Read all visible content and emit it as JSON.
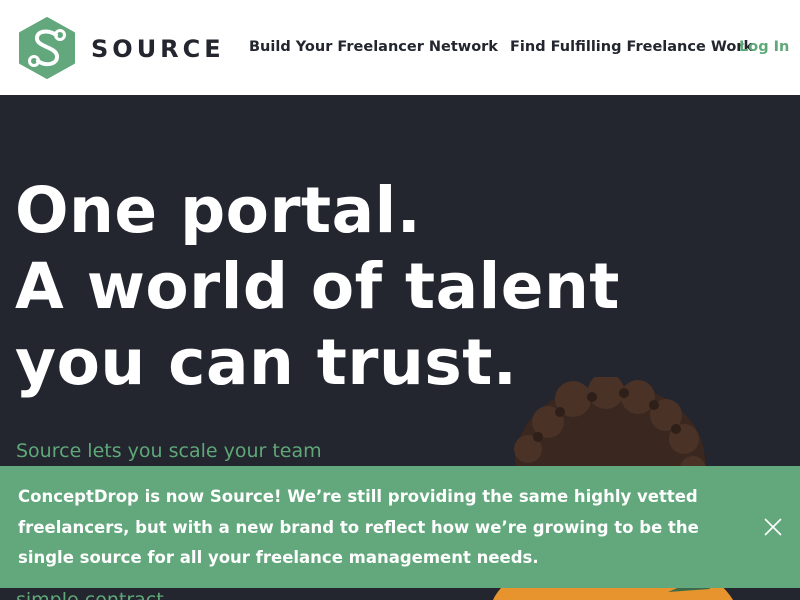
{
  "brand": {
    "name": "SOURCE",
    "accent": "#5fa878",
    "dark": "#23252f"
  },
  "nav": {
    "build_label": "Build Your Freelancer Network",
    "find_label": "Find Fulfilling Freelance Work",
    "login_label": "Log In"
  },
  "hero": {
    "headline": [
      "One portal.",
      "A world of talent",
      "you can trust."
    ],
    "subtext": "Source lets you scale your team",
    "subtext_partial": "simple contract"
  },
  "banner": {
    "message": "ConceptDrop is now Source! We’re still providing the same highly vetted freelancers, but with a new brand to reflect how we’re growing to be the single source for all your freelance management needs.",
    "close_icon": "close-icon"
  }
}
